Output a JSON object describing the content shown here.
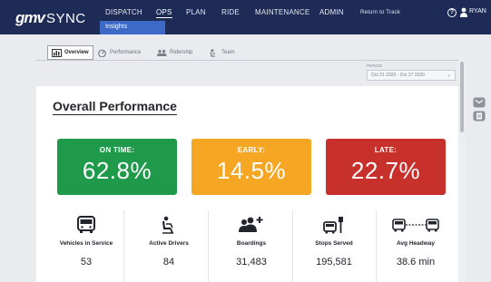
{
  "app": {
    "logo_gmv": "gmv",
    "logo_sync": "SYNC"
  },
  "nav": {
    "items": [
      {
        "label": "DISPATCH"
      },
      {
        "label": "OPS"
      },
      {
        "label": "PLAN"
      },
      {
        "label": "RIDE"
      },
      {
        "label": "MAINTENANCE"
      },
      {
        "label": "ADMIN"
      },
      {
        "label": "Return to Track"
      }
    ],
    "sub_tab": "Insights",
    "help": "?",
    "user_name": "RYAN"
  },
  "page_tabs": [
    {
      "label": "Overview",
      "icon": "bar-chart-icon"
    },
    {
      "label": "Performance",
      "icon": "gauge-icon"
    },
    {
      "label": "Ridership",
      "icon": "people-icon"
    },
    {
      "label": "Team",
      "icon": "driver-icon"
    }
  ],
  "filter": {
    "period_label": "PERIOD",
    "period_value": "Oct 21 2020 - Oct 27 2020"
  },
  "overview": {
    "title": "Overall Performance",
    "kpis": [
      {
        "label": "ON TIME:",
        "value": "62.8%",
        "color": "#1e9a4a"
      },
      {
        "label": "EARLY:",
        "value": "14.5%",
        "color": "#f5a623"
      },
      {
        "label": "LATE:",
        "value": "22.7%",
        "color": "#c8312b"
      }
    ],
    "stats": [
      {
        "label": "Vehicles in Service",
        "value": "53",
        "icon": "bus-icon"
      },
      {
        "label": "Active Drivers",
        "value": "84",
        "icon": "driver-seat-icon"
      },
      {
        "label": "Boardings",
        "value": "31,483",
        "icon": "group-add-icon"
      },
      {
        "label": "Stops Served",
        "value": "195,581",
        "icon": "bus-stop-icon"
      },
      {
        "label": "Avg Headway",
        "value": "38.6 min",
        "icon": "headway-icon"
      }
    ]
  },
  "colors": {
    "nav_bg": "#1d2b56",
    "accent": "#3d69c7"
  }
}
